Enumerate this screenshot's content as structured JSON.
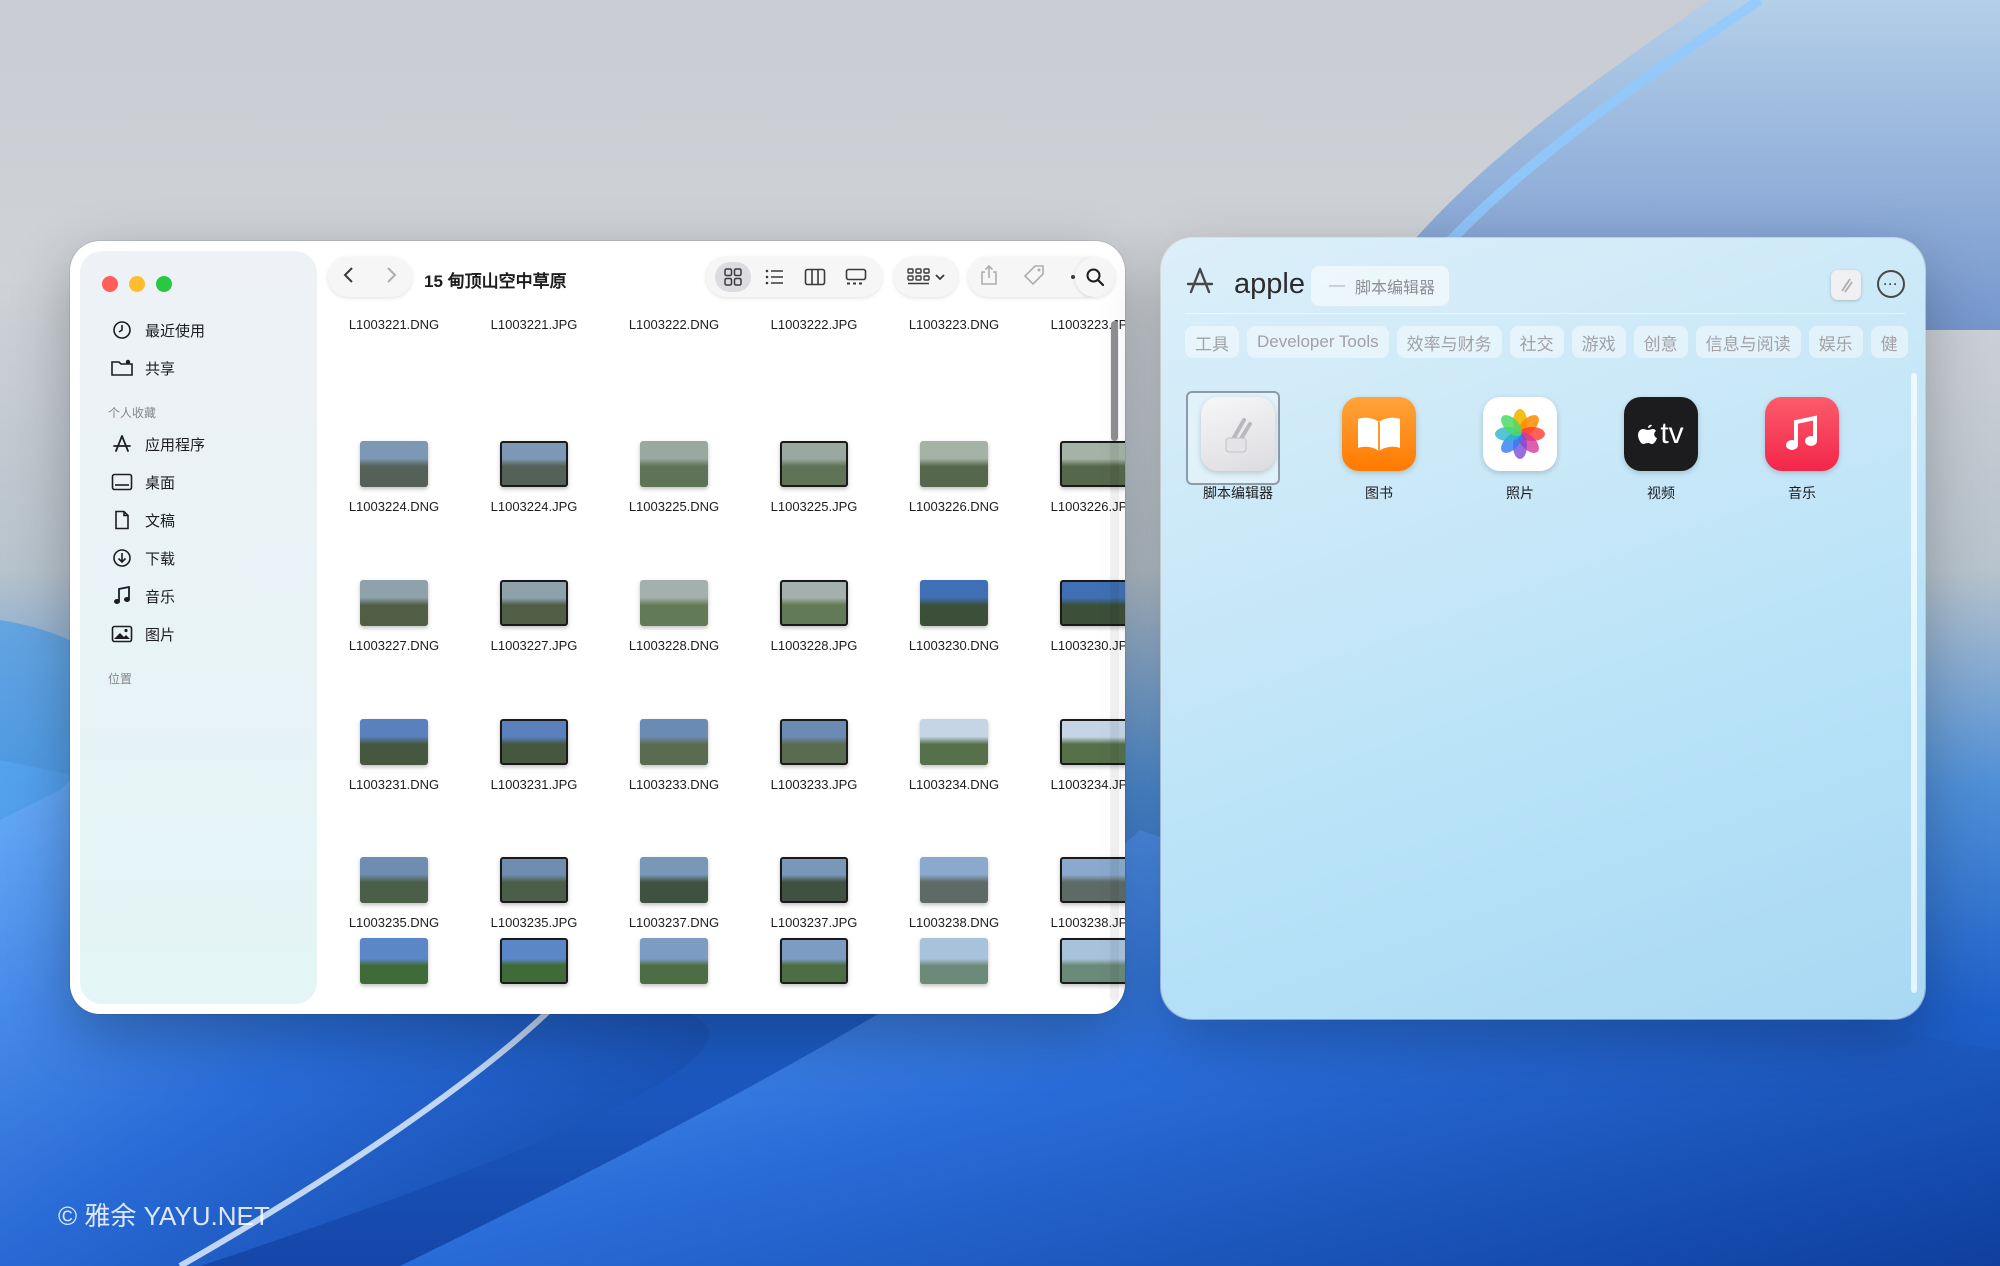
{
  "finder": {
    "title": "15 甸顶山空中草原",
    "sidebar": {
      "items_top": [
        {
          "label": "最近使用",
          "icon": "clock-icon"
        },
        {
          "label": "共享",
          "icon": "shared-folder-icon"
        }
      ],
      "favorites_header": "个人收藏",
      "favorites": [
        {
          "label": "应用程序",
          "icon": "applications-icon"
        },
        {
          "label": "桌面",
          "icon": "desktop-icon"
        },
        {
          "label": "文稿",
          "icon": "document-icon"
        },
        {
          "label": "下载",
          "icon": "download-icon"
        },
        {
          "label": "音乐",
          "icon": "music-note-icon"
        },
        {
          "label": "图片",
          "icon": "photo-icon"
        }
      ],
      "locations_header": "位置"
    },
    "files": [
      [
        "L1003221.DNG",
        "L1003221.JPG",
        "L1003222.DNG",
        "L1003222.JPG",
        "L1003223.DNG",
        "L1003223.JPG"
      ],
      [
        "L1003224.DNG",
        "L1003224.JPG",
        "L1003225.DNG",
        "L1003225.JPG",
        "L1003226.DNG",
        "L1003226.JPG"
      ],
      [
        "L1003227.DNG",
        "L1003227.JPG",
        "L1003228.DNG",
        "L1003228.JPG",
        "L1003230.DNG",
        "L1003230.JPG"
      ],
      [
        "L1003231.DNG",
        "L1003231.JPG",
        "L1003233.DNG",
        "L1003233.JPG",
        "L1003234.DNG",
        "L1003234.JPG"
      ],
      [
        "L1003235.DNG",
        "L1003235.JPG",
        "L1003237.DNG",
        "L1003237.JPG",
        "L1003238.DNG",
        "L1003238.JPG"
      ]
    ]
  },
  "store": {
    "query": "apple",
    "token": "脚本编辑器",
    "tabs": [
      "工具",
      "Developer Tools",
      "效率与财务",
      "社交",
      "游戏",
      "创意",
      "信息与阅读",
      "娱乐",
      "健"
    ],
    "apps": [
      {
        "label": "脚本编辑器",
        "icon": "script-editor-icon"
      },
      {
        "label": "图书",
        "icon": "books-icon"
      },
      {
        "label": "照片",
        "icon": "photos-icon"
      },
      {
        "label": "视频",
        "icon": "apple-tv-icon"
      },
      {
        "label": "音乐",
        "icon": "music-icon"
      }
    ],
    "tv_text": "tv"
  },
  "watermark": "© 雅余 YAYU.NET",
  "colors": {
    "traffic_red": "#ff5f57",
    "traffic_yellow": "#febc2e",
    "traffic_green": "#28c840",
    "books": "#ff8a00",
    "music": "#fc3c44",
    "tv": "#1c1c1e"
  }
}
